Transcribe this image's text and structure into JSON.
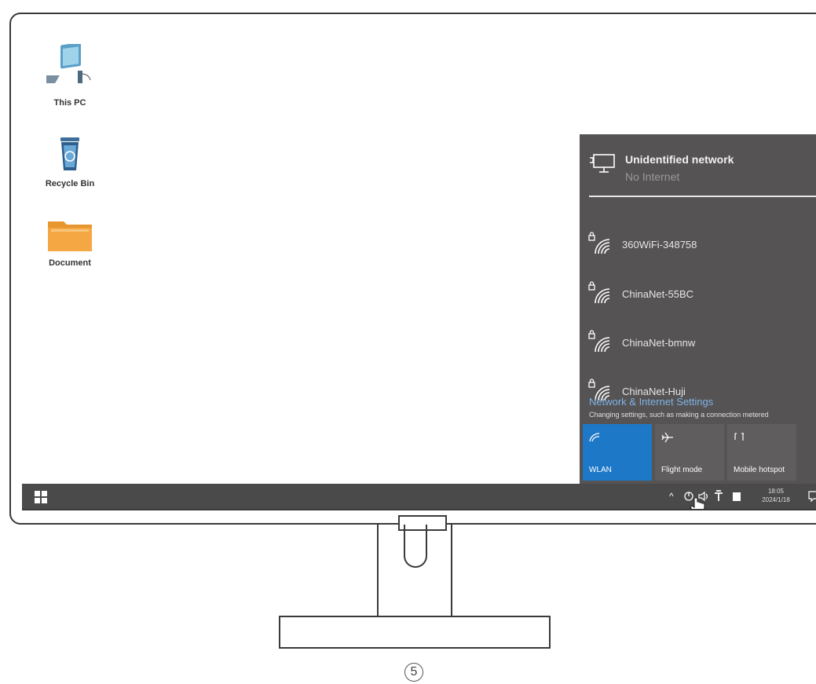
{
  "desktop": {
    "icons": [
      {
        "label": "This PC",
        "icon": "computer-icon"
      },
      {
        "label": "Recycle Bin",
        "icon": "recycle-bin-icon"
      },
      {
        "label": "Document",
        "icon": "folder-icon"
      }
    ]
  },
  "network_flyout": {
    "current": {
      "name": "Unidentified network",
      "status": "No Internet"
    },
    "networks": [
      {
        "name": "360WiFi-348758"
      },
      {
        "name": "ChinaNet-55BC"
      },
      {
        "name": "ChinaNet-bmnw"
      },
      {
        "name": "ChinaNet-Huji"
      }
    ],
    "settings_link": "Network & Internet Settings",
    "settings_hint": "Changing settings, such as making a connection metered",
    "tiles": [
      {
        "label": "WLAN",
        "active": true,
        "icon": "wifi-icon"
      },
      {
        "label": "Flight mode",
        "active": false,
        "icon": "airplane-icon"
      },
      {
        "label": "Mobile hotspot",
        "active": false,
        "icon": "hotspot-icon"
      }
    ]
  },
  "taskbar": {
    "clock_time": "18:05",
    "clock_date": "2024/1/18"
  },
  "step_number": "5",
  "colors": {
    "taskbar": "#4a4a4a",
    "flyout": "#555353",
    "accent": "#1e78c8",
    "link": "#7fb3e6"
  }
}
